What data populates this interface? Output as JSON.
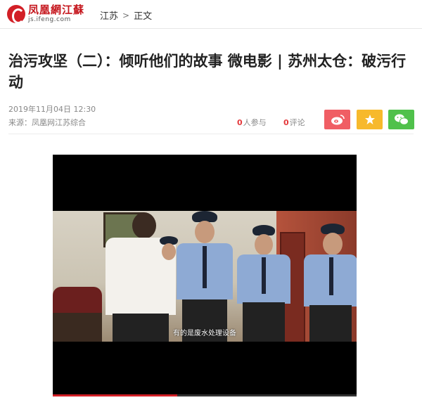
{
  "header": {
    "logo_cn": "凤凰網江蘇",
    "logo_en": "js.ifeng.com",
    "breadcrumb": [
      "江苏",
      "正文"
    ]
  },
  "article": {
    "title": "治污攻坚（二）：倾听他们的故事 微电影 | 苏州太仓：破污行动",
    "date": "2019年11月04日 12:30",
    "source": "来源：凤凰网江苏综合",
    "participants": "0",
    "participants_label": "人参与",
    "comments": "0",
    "comments_label": "评论"
  },
  "share": {
    "weibo_icon": "weibo-icon",
    "favorite_icon": "star-icon",
    "wechat_icon": "wechat-icon",
    "colors": {
      "weibo": "#f05e64",
      "favorite": "#f7b92c",
      "wechat": "#50c14b"
    }
  },
  "video": {
    "subtitle": "有的是废水处理设备",
    "progress": 0.41
  },
  "colors": {
    "brand": "#d21f26",
    "accent_number": "#e4393c"
  }
}
